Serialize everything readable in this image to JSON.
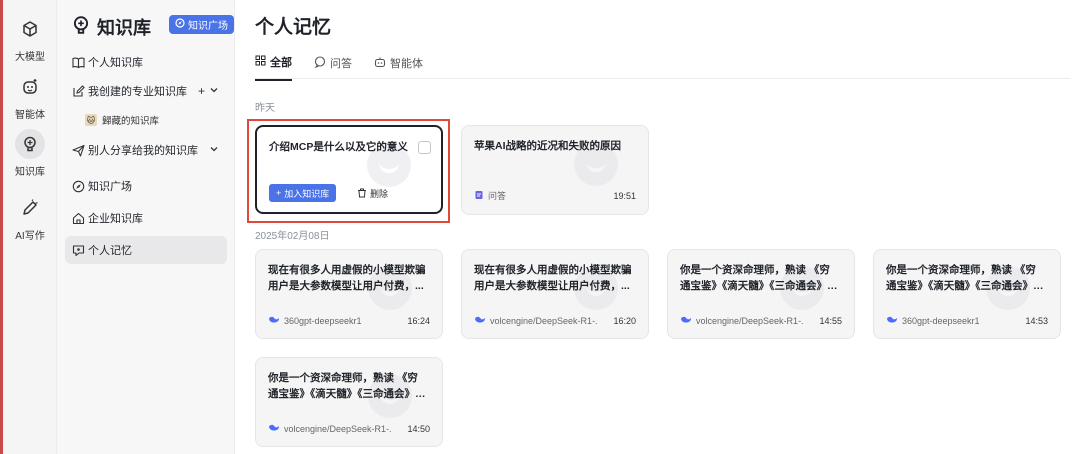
{
  "rail": {
    "items": [
      {
        "label": "大模型",
        "icon": "cube-icon"
      },
      {
        "label": "智能体",
        "icon": "bot-face-icon"
      },
      {
        "label": "知识库",
        "icon": "lightbulb-icon"
      },
      {
        "label": "AI写作",
        "icon": "pen-icon"
      }
    ],
    "active_index": 2
  },
  "sidebar": {
    "title": "知识库",
    "plaza_badge": "知识广场",
    "items": [
      {
        "label": "个人知识库",
        "icon": "book-icon"
      },
      {
        "label": "我创建的专业知识库",
        "icon": "edit-icon"
      },
      {
        "label": "别人分享给我的知识库",
        "icon": "send-icon"
      },
      {
        "label": "知识广场",
        "icon": "compass-icon"
      },
      {
        "label": "企业知识库",
        "icon": "home-icon"
      },
      {
        "label": "个人记忆",
        "icon": "memory-icon"
      }
    ],
    "sub_item": "歸藏的知识库"
  },
  "main": {
    "title": "个人记忆",
    "tabs": [
      {
        "label": "全部",
        "icon": "grid-icon"
      },
      {
        "label": "问答",
        "icon": "chat-icon"
      },
      {
        "label": "智能体",
        "icon": "bot-icon"
      }
    ],
    "active_tab": 0,
    "groups": [
      {
        "label": "昨天",
        "cards": [
          {
            "title": "介绍MCP是什么以及它的意义",
            "add_label": "加入知识库",
            "delete_label": "删除"
          },
          {
            "title": "苹果AI战略的近况和失败的原因",
            "source": "问答",
            "time": "19:51"
          }
        ]
      },
      {
        "label": "2025年02月08日",
        "cards": [
          {
            "title": "现在有很多人用虚假的小模型欺骗用户是大参数模型让用户付费，...",
            "source": "360gpt-deepseekr1",
            "time": "16:24"
          },
          {
            "title": "现在有很多人用虚假的小模型欺骗用户是大参数模型让用户付费，...",
            "source": "volcengine/DeepSeek-R1-...",
            "time": "16:20"
          },
          {
            "title": "你是一个资深命理师，熟读 《穷通宝鉴》《滴天髓》《三命通会》《子...",
            "source": "volcengine/DeepSeek-R1-...",
            "time": "14:55"
          },
          {
            "title": "你是一个资深命理师，熟读 《穷通宝鉴》《滴天髓》《三命通会》《子...",
            "source": "360gpt-deepseekr1",
            "time": "14:53"
          },
          {
            "title": "你是一个资深命理师，熟读 《穷通宝鉴》《滴天髓》《三命通会》《子...",
            "source": "volcengine/DeepSeek-R1-...",
            "time": "14:50"
          }
        ]
      }
    ]
  },
  "colors": {
    "accent": "#4a73e8",
    "highlight": "#e0483a",
    "rail_accent": "#c94a4a"
  }
}
